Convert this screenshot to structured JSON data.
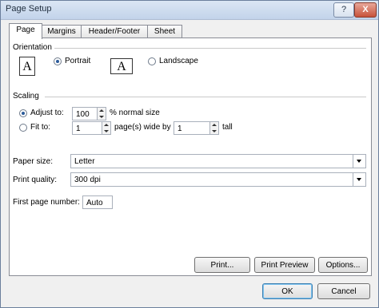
{
  "window": {
    "title": "Page Setup",
    "help_label": "?",
    "close_label": "X"
  },
  "tabs": [
    {
      "label": "Page",
      "active": true
    },
    {
      "label": "Margins",
      "active": false
    },
    {
      "label": "Header/Footer",
      "active": false
    },
    {
      "label": "Sheet",
      "active": false
    }
  ],
  "orientation": {
    "heading": "Orientation",
    "portrait_label": "Portrait",
    "landscape_label": "Landscape",
    "selected": "portrait",
    "icon_glyph": "A"
  },
  "scaling": {
    "heading": "Scaling",
    "adjust_label": "Adjust to:",
    "adjust_value": "100",
    "adjust_suffix": "% normal size",
    "fit_label": "Fit to:",
    "fit_wide_value": "1",
    "fit_wide_suffix": "page(s) wide by",
    "fit_tall_value": "1",
    "fit_tall_suffix": "tall",
    "selected": "adjust"
  },
  "paper_size": {
    "label": "Paper size:",
    "value": "Letter"
  },
  "print_quality": {
    "label": "Print quality:",
    "value": "300 dpi"
  },
  "first_page_number": {
    "label": "First page number:",
    "value": "Auto"
  },
  "panel_buttons": {
    "print": "Print...",
    "preview": "Print Preview",
    "options": "Options..."
  },
  "dialog_buttons": {
    "ok": "OK",
    "cancel": "Cancel"
  },
  "colors": {
    "title_bar": "#c2d3ea",
    "accent": "#3c7fb1",
    "close": "#c8523a"
  }
}
